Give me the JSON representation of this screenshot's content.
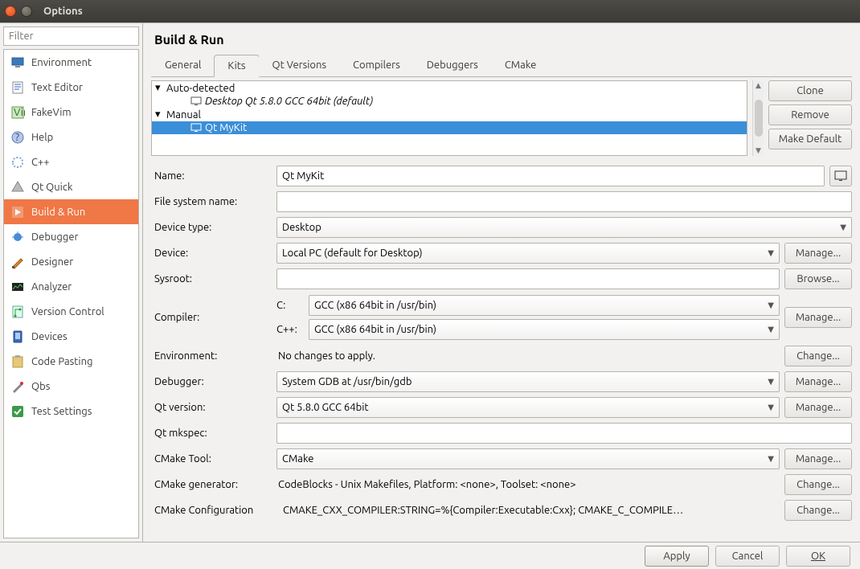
{
  "window": {
    "title": "Options"
  },
  "filter_placeholder": "Filter",
  "categories": [
    {
      "label": "Environment",
      "icon": "monitor"
    },
    {
      "label": "Text Editor",
      "icon": "texteditor"
    },
    {
      "label": "FakeVim",
      "icon": "fakevim"
    },
    {
      "label": "Help",
      "icon": "help"
    },
    {
      "label": "C++",
      "icon": "cpp"
    },
    {
      "label": "Qt Quick",
      "icon": "qtquick"
    },
    {
      "label": "Build & Run",
      "icon": "buildrun",
      "selected": true
    },
    {
      "label": "Debugger",
      "icon": "debugger"
    },
    {
      "label": "Designer",
      "icon": "designer"
    },
    {
      "label": "Analyzer",
      "icon": "analyzer"
    },
    {
      "label": "Version Control",
      "icon": "vcs"
    },
    {
      "label": "Devices",
      "icon": "devices"
    },
    {
      "label": "Code Pasting",
      "icon": "codepaste"
    },
    {
      "label": "Qbs",
      "icon": "qbs"
    },
    {
      "label": "Test Settings",
      "icon": "test"
    }
  ],
  "page_title": "Build & Run",
  "tabs": [
    {
      "label": "General"
    },
    {
      "label": "Kits",
      "active": true
    },
    {
      "label": "Qt Versions"
    },
    {
      "label": "Compilers"
    },
    {
      "label": "Debuggers"
    },
    {
      "label": "CMake"
    }
  ],
  "kits_tree": {
    "auto_label": "Auto-detected",
    "auto_item": "Desktop Qt 5.8.0 GCC 64bit (default)",
    "manual_label": "Manual",
    "manual_item": "Qt MyKit"
  },
  "side_buttons": {
    "clone": "Clone",
    "remove": "Remove",
    "make_default": "Make Default"
  },
  "form": {
    "name_label": "Name:",
    "name_value": "Qt MyKit",
    "fsname_label": "File system name:",
    "fsname_value": "",
    "devtype_label": "Device type:",
    "devtype_value": "Desktop",
    "device_label": "Device:",
    "device_value": "Local PC (default for Desktop)",
    "device_btn": "Manage...",
    "sysroot_label": "Sysroot:",
    "sysroot_value": "",
    "sysroot_btn": "Browse...",
    "compiler_label": "Compiler:",
    "compiler_c_label": "C:",
    "compiler_c_value": "GCC (x86 64bit in /usr/bin)",
    "compiler_cxx_label": "C++:",
    "compiler_cxx_value": "GCC (x86 64bit in /usr/bin)",
    "compiler_btn": "Manage...",
    "env_label": "Environment:",
    "env_value": "No changes to apply.",
    "env_btn": "Change...",
    "debugger_label": "Debugger:",
    "debugger_value": "System GDB at /usr/bin/gdb",
    "debugger_btn": "Manage...",
    "qtver_label": "Qt version:",
    "qtver_value": "Qt 5.8.0 GCC 64bit",
    "qtver_btn": "Manage...",
    "mkspec_label": "Qt mkspec:",
    "mkspec_value": "",
    "cmaketool_label": "CMake Tool:",
    "cmaketool_value": "CMake",
    "cmaketool_btn": "Manage...",
    "cmakegen_label": "CMake generator:",
    "cmakegen_value": "CodeBlocks - Unix Makefiles, Platform: <none>, Toolset: <none>",
    "cmakegen_btn": "Change...",
    "cmakecfg_label": "CMake Configuration",
    "cmakecfg_value": "CMAKE_CXX_COMPILER:STRING=%{Compiler:Executable:Cxx}; CMAKE_C_COMPILE…",
    "cmakecfg_btn": "Change..."
  },
  "footer": {
    "apply": "Apply",
    "cancel": "Cancel",
    "ok": "OK"
  }
}
